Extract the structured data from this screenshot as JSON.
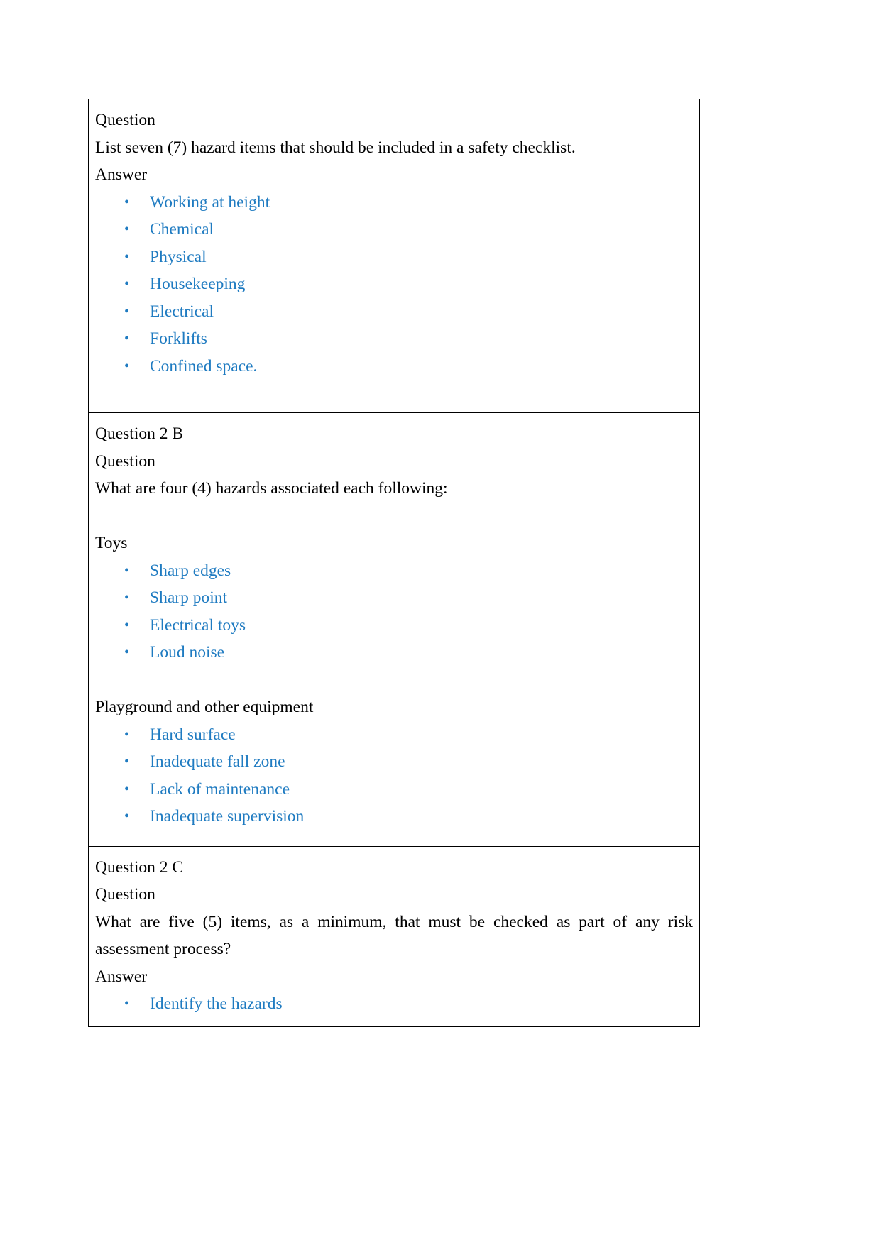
{
  "document": {
    "bullet_glyph": "•",
    "accent_color": "#1F7BC1",
    "text_color": "#000000",
    "sections": [
      {
        "id": "question-1",
        "heading_label": "Question",
        "question_text": "List seven (7) hazard items that should be included in a safety checklist.",
        "answer_label": "Answer",
        "answers": [
          "Working at height",
          "Chemical",
          "Physical",
          "Housekeeping",
          "Electrical",
          "Forklifts",
          "Confined space."
        ]
      },
      {
        "id": "question-2b",
        "title": "Question 2 B",
        "heading_label": "Question",
        "question_text": "What are four (4) hazards associated each following:",
        "group_one_label": "Toys",
        "group_one_items": [
          "Sharp edges",
          "Sharp point",
          "Electrical toys",
          "Loud noise"
        ],
        "group_two_label": "Playground and other equipment",
        "group_two_items": [
          "Hard surface",
          "Inadequate fall zone",
          "Lack of maintenance",
          "Inadequate supervision"
        ]
      },
      {
        "id": "question-2c",
        "title": "Question 2 C",
        "heading_label": "Question",
        "question_text": "What are five (5) items, as a minimum, that must be checked as part of any risk assessment process?",
        "answer_label": "Answer",
        "answers": [
          "Identify the hazards"
        ]
      }
    ]
  }
}
